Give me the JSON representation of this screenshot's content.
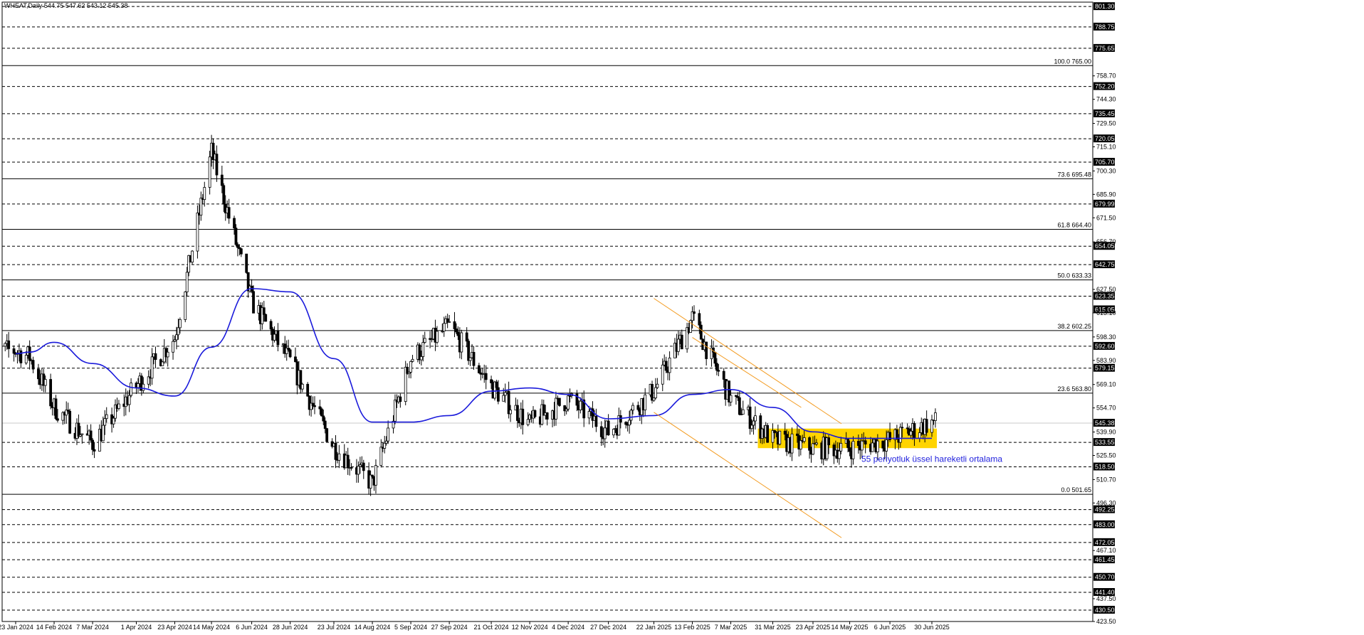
{
  "header": {
    "title": "WHEAT,Daily  544.75 547.62 543.12 545.38"
  },
  "colors": {
    "background": "#ffffff",
    "candle": "#000000",
    "ema": "#1a1adb",
    "channel": "#f39a1e",
    "zone": "#ffd400",
    "level_box": "#000000",
    "annotation": "#2222dd"
  },
  "chart_data": {
    "type": "candlestick",
    "symbol": "WHEAT",
    "timeframe": "Daily",
    "ohlc_header": {
      "open": 544.75,
      "high": 547.62,
      "low": 543.12,
      "close": 545.38
    },
    "ylim": [
      423.5,
      804.0
    ],
    "price_tick_labels": [
      "801.30",
      "788.75",
      "775.65",
      "758.70",
      "752.20",
      "744.30",
      "735.45",
      "729.50",
      "720.05",
      "715.10",
      "705.70",
      "700.30",
      "685.90",
      "679.99",
      "671.50",
      "656.70",
      "654.05",
      "642.75",
      "627.50",
      "623.35",
      "615.05",
      "613.10",
      "598.30",
      "592.60",
      "583.90",
      "579.15",
      "569.10",
      "554.70",
      "545.38",
      "539.90",
      "533.55",
      "525.50",
      "518.50",
      "510.70",
      "496.30",
      "492.25",
      "483.00",
      "472.05",
      "467.10",
      "461.45",
      "450.70",
      "441.40",
      "437.50",
      "430.50",
      "423.50"
    ],
    "boxed_levels": [
      801.3,
      788.75,
      775.65,
      752.2,
      735.45,
      720.05,
      705.7,
      679.99,
      654.05,
      642.75,
      623.35,
      615.05,
      592.6,
      579.15,
      545.38,
      533.55,
      518.5,
      492.25,
      483.0,
      472.05,
      461.45,
      450.7,
      441.4,
      430.5
    ],
    "dashed_levels": [
      801.3,
      788.75,
      775.65,
      752.2,
      735.45,
      720.05,
      705.7,
      679.99,
      654.05,
      642.75,
      623.35,
      592.6,
      579.15,
      533.55,
      518.5,
      492.25,
      483.0,
      472.05,
      461.45,
      450.7,
      441.4,
      430.5
    ],
    "fibonacci": [
      {
        "label": "100.0 765.00",
        "price": 765.0
      },
      {
        "label": "73.6 695.48",
        "price": 695.48
      },
      {
        "label": "61.8 664.40",
        "price": 664.4
      },
      {
        "label": "50.0 633.33",
        "price": 633.33
      },
      {
        "label": "38.2 602.25",
        "price": 602.25
      },
      {
        "label": "23.6 563.80",
        "price": 563.8
      },
      {
        "label": "0.0 501.65",
        "price": 501.65
      }
    ],
    "current_price": 545.38,
    "x_tick_labels": [
      "23 Jan 2024",
      "14 Feb 2024",
      "7 Mar 2024",
      "1 Apr 2024",
      "23 Apr 2024",
      "14 May 2024",
      "6 Jun 2024",
      "28 Jun 2024",
      "23 Jul 2024",
      "14 Aug 2024",
      "5 Sep 2024",
      "27 Sep 2024",
      "21 Oct 2024",
      "12 Nov 2024",
      "4 Dec 2024",
      "27 Dec 2024",
      "22 Jan 2025",
      "13 Feb 2025",
      "7 Mar 2025",
      "31 Mar 2025",
      "23 Apr 2025",
      "14 May 2025",
      "6 Jun 2025",
      "30 Jun 2025"
    ],
    "price_path_dates": [
      "23 Jan 2024",
      "31 Jan 2024",
      "14 Feb 2024",
      "7 Mar 2024",
      "1 Apr 2024",
      "23 Apr 2024",
      "14 May 2024",
      "6 Jun 2024",
      "28 Jun 2024",
      "23 Jul 2024",
      "14 Aug 2024",
      "5 Sep 2024",
      "27 Sep 2024",
      "21 Oct 2024",
      "12 Nov 2024",
      "4 Dec 2024",
      "27 Dec 2024",
      "22 Jan 2025",
      "13 Feb 2025",
      "7 Mar 2025",
      "31 Mar 2025",
      "23 Apr 2025",
      "14 May 2025",
      "6 Jun 2025",
      "30 Jun 2025"
    ],
    "price_path": [
      590,
      586,
      555,
      533,
      568,
      598,
      712,
      620,
      583,
      531,
      508,
      585,
      605,
      568,
      545,
      560,
      540,
      565,
      610,
      560,
      535,
      530,
      530,
      535,
      546
    ],
    "ema_label": "55 periyotluk üssel hareketli ortalama",
    "ema_path": [
      588,
      589,
      595,
      582,
      567,
      562,
      592,
      628,
      626,
      585,
      546,
      546,
      550,
      565,
      567,
      563,
      548,
      550,
      563,
      566,
      555,
      540,
      536,
      536,
      536
    ],
    "channel": {
      "upper": {
        "start": [
          "22 Jan 2025",
          622
        ],
        "end": [
          "23 Apr 2025",
          550
        ]
      },
      "lower": {
        "start": [
          "22 Jan 2025",
          552
        ],
        "end": [
          "23 Apr 2025",
          480
        ]
      },
      "mid": {
        "start": [
          "13 Feb 2025",
          598
        ],
        "end": [
          "31 Mar 2025",
          560
        ]
      }
    },
    "support_zone": {
      "price_low": 530,
      "price_high": 542,
      "start_date": "7 Mar 2025",
      "end_date": "30 Jun 2025"
    }
  }
}
